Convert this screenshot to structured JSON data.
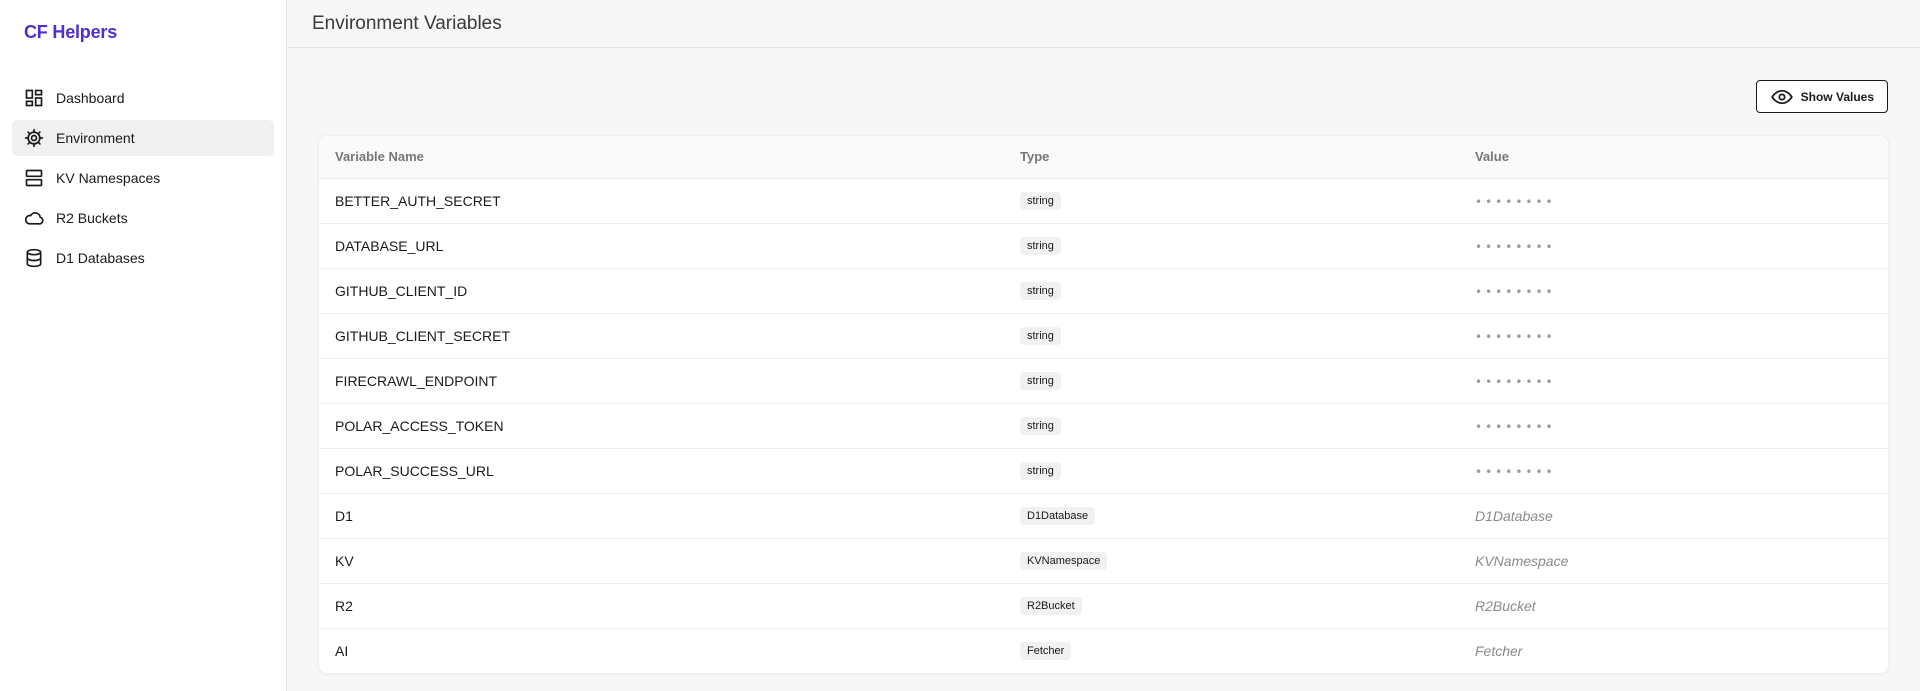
{
  "brand": {
    "title": "CF Helpers",
    "color": "#4f2fd0"
  },
  "sidebar": {
    "items": [
      {
        "label": "Dashboard",
        "icon": "dashboard-icon",
        "active": false
      },
      {
        "label": "Environment",
        "icon": "settings-cog-icon",
        "active": true
      },
      {
        "label": "KV Namespaces",
        "icon": "server-icon",
        "active": false
      },
      {
        "label": "R2 Buckets",
        "icon": "cloud-icon",
        "active": false
      },
      {
        "label": "D1 Databases",
        "icon": "database-icon",
        "active": false
      }
    ]
  },
  "header": {
    "title": "Environment Variables"
  },
  "toolbar": {
    "show_values_label": "Show Values",
    "show_values_icon": "eye-icon"
  },
  "table": {
    "columns": [
      "Variable Name",
      "Type",
      "Value"
    ],
    "rows": [
      {
        "name": "BETTER_AUTH_SECRET",
        "type": "string",
        "value": "••••••••"
      },
      {
        "name": "DATABASE_URL",
        "type": "string",
        "value": "••••••••"
      },
      {
        "name": "GITHUB_CLIENT_ID",
        "type": "string",
        "value": "••••••••"
      },
      {
        "name": "GITHUB_CLIENT_SECRET",
        "type": "string",
        "value": "••••••••"
      },
      {
        "name": "FIRECRAWL_ENDPOINT",
        "type": "string",
        "value": "••••••••"
      },
      {
        "name": "POLAR_ACCESS_TOKEN",
        "type": "string",
        "value": "••••••••"
      },
      {
        "name": "POLAR_SUCCESS_URL",
        "type": "string",
        "value": "••••••••"
      },
      {
        "name": "D1",
        "type": "D1Database",
        "value": "D1Database"
      },
      {
        "name": "KV",
        "type": "KVNamespace",
        "value": "KVNamespace"
      },
      {
        "name": "R2",
        "type": "R2Bucket",
        "value": "R2Bucket"
      },
      {
        "name": "AI",
        "type": "Fetcher",
        "value": "Fetcher"
      }
    ]
  }
}
